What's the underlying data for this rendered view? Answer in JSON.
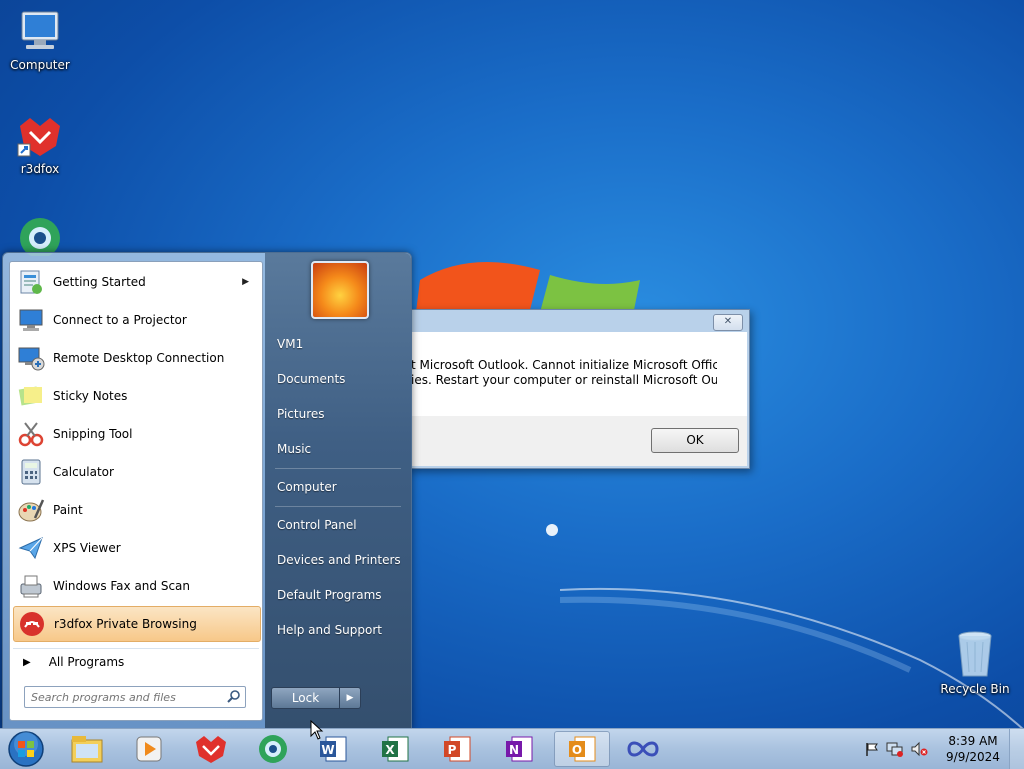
{
  "desktop": {
    "icons": [
      {
        "label": "Computer"
      },
      {
        "label": "r3dfox"
      },
      {
        "label": "Recycle Bin"
      }
    ]
  },
  "dialog": {
    "close_glyph": "✕",
    "message_line1": "t Microsoft Outlook. Cannot initialize Microsoft Office",
    "message_line2": "ies. Restart your computer or reinstall Microsoft Outlook.",
    "ok_label": "OK"
  },
  "start_menu": {
    "programs": [
      {
        "label": "Getting Started",
        "icon": "getting-started-icon",
        "has_submenu": true
      },
      {
        "label": "Connect to a Projector",
        "icon": "projector-icon"
      },
      {
        "label": "Remote Desktop Connection",
        "icon": "remote-desktop-icon"
      },
      {
        "label": "Sticky Notes",
        "icon": "sticky-notes-icon"
      },
      {
        "label": "Snipping Tool",
        "icon": "snipping-tool-icon"
      },
      {
        "label": "Calculator",
        "icon": "calculator-icon"
      },
      {
        "label": "Paint",
        "icon": "paint-icon"
      },
      {
        "label": "XPS Viewer",
        "icon": "xps-viewer-icon"
      },
      {
        "label": "Windows Fax and Scan",
        "icon": "fax-scan-icon"
      },
      {
        "label": "r3dfox Private Browsing",
        "icon": "r3dfox-private-icon",
        "highlighted": true
      }
    ],
    "submenu_arrow": "▶",
    "all_programs_arrow": "▶",
    "all_programs_label": "All Programs",
    "search_placeholder": "Search programs and files",
    "right_links": [
      {
        "label": "VM1"
      },
      {
        "label": "Documents"
      },
      {
        "label": "Pictures"
      },
      {
        "label": "Music"
      },
      {
        "label": "Computer"
      },
      {
        "label": "Control Panel"
      },
      {
        "label": "Devices and Printers"
      },
      {
        "label": "Default Programs"
      },
      {
        "label": "Help and Support"
      }
    ],
    "lock_label": "Lock",
    "lock_arrow": "▶"
  },
  "taskbar": {
    "pinned": [
      {
        "icon": "explorer-icon"
      },
      {
        "icon": "media-player-icon"
      },
      {
        "icon": "r3dfox-icon"
      },
      {
        "icon": "browser-globe-icon"
      },
      {
        "icon": "word-icon"
      },
      {
        "icon": "excel-icon"
      },
      {
        "icon": "powerpoint-icon"
      },
      {
        "icon": "onenote-icon"
      },
      {
        "icon": "outlook-icon",
        "active": true
      },
      {
        "icon": "infinity-icon"
      }
    ],
    "clock_time": "8:39 AM",
    "clock_date": "9/9/2024"
  },
  "colors": {
    "desktop_blue": "#1a6dc8",
    "highlight_orange": "#f7c889",
    "taskbar": "#a9c2df"
  }
}
